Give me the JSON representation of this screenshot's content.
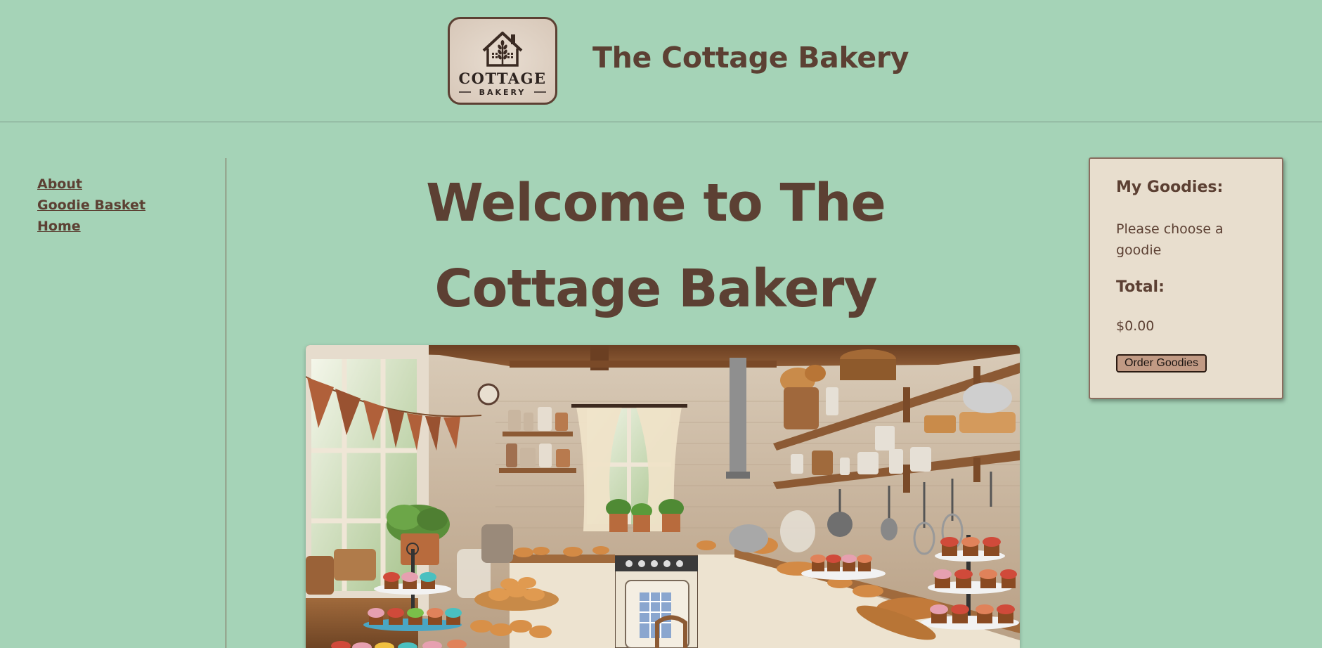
{
  "header": {
    "logo": {
      "icon": "house-wheat-icon",
      "line1": "COTTAGE",
      "line2": "BAKERY"
    },
    "title": "The Cottage Bakery"
  },
  "nav": {
    "items": [
      {
        "label": "About"
      },
      {
        "label": "Goodie Basket"
      },
      {
        "label": "Home"
      }
    ]
  },
  "main": {
    "heading_line1": "Welcome to The",
    "heading_line2": "Cottage Bakery",
    "hero_image": "cottage-bakery-kitchen-image"
  },
  "basket": {
    "heading": "My Goodies:",
    "empty_message": "Please choose a goodie",
    "total_label": "Total:",
    "total_value": "$0.00",
    "order_button": "Order Goodies"
  },
  "colors": {
    "background": "#a5d3b7",
    "text_brown": "#5c4033",
    "panel": "#e8dece",
    "button": "#c19a84"
  }
}
